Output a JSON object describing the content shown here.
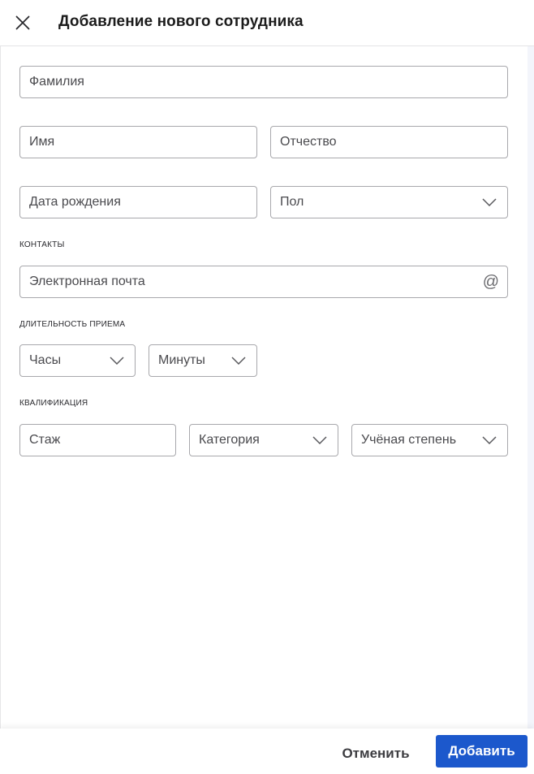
{
  "header": {
    "title": "Добавление нового сотрудника",
    "close_icon": "close-icon"
  },
  "form": {
    "last_name": {
      "placeholder": "Фамилия",
      "value": ""
    },
    "first_name": {
      "placeholder": "Имя",
      "value": ""
    },
    "middle_name": {
      "placeholder": "Отчество",
      "value": ""
    },
    "birth_date": {
      "placeholder": "Дата рождения",
      "value": ""
    },
    "gender": {
      "placeholder": "Пол",
      "icon": "chevron-down-icon"
    },
    "contacts_section": {
      "label": "КОНТАКТЫ"
    },
    "email": {
      "placeholder": "Электронная почта",
      "value": "",
      "icon": "at-icon",
      "icon_glyph": "@"
    },
    "duration_section": {
      "label": "ДЛИТЕЛЬНОСТЬ ПРИЕМА"
    },
    "hours": {
      "placeholder": "Часы",
      "icon": "chevron-down-icon"
    },
    "minutes": {
      "placeholder": "Минуты",
      "icon": "chevron-down-icon"
    },
    "qualification_section": {
      "label": "КВАЛИФИКАЦИЯ"
    },
    "experience": {
      "placeholder": "Стаж",
      "value": ""
    },
    "category": {
      "placeholder": "Категория",
      "icon": "chevron-down-icon"
    },
    "degree": {
      "placeholder": "Учёная степень",
      "icon": "chevron-down-icon"
    }
  },
  "footer": {
    "cancel_label": "Отменить",
    "add_label": "Добавить"
  },
  "colors": {
    "primary": "#1c58cc",
    "border": "#a8a8ac",
    "text": "#1c1c1c"
  }
}
